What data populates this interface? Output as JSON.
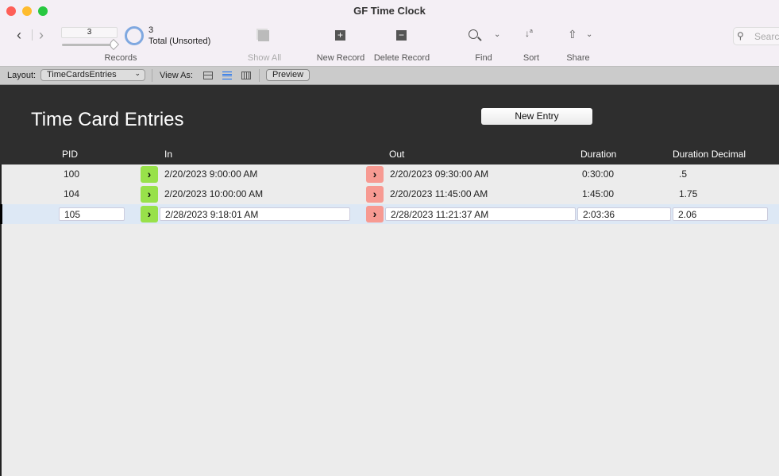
{
  "window": {
    "title": "GF Time Clock"
  },
  "toolbar": {
    "record_number": "3",
    "found_count": "3",
    "total_label": "Total (Unsorted)",
    "records_label": "Records",
    "show_all": "Show All",
    "new_record": "New Record",
    "delete_record": "Delete Record",
    "find": "Find",
    "sort": "Sort",
    "share": "Share",
    "search_placeholder": "Search"
  },
  "layout_bar": {
    "layout_label": "Layout:",
    "layout_value": "TimeCardsEntries",
    "view_as_label": "View As:",
    "preview": "Preview",
    "active_view": "list"
  },
  "header": {
    "title": "Time Card Entries",
    "new_entry": "New Entry",
    "columns": {
      "pid": "PID",
      "in": "In",
      "out": "Out",
      "duration": "Duration",
      "duration_decimal": "Duration Decimal"
    }
  },
  "rows": [
    {
      "pid": "100",
      "in": "2/20/2023 9:00:00 AM",
      "out": "2/20/2023 09:30:00 AM",
      "duration": "0:30:00",
      "duration_decimal": ".5"
    },
    {
      "pid": "104",
      "in": "2/20/2023 10:00:00 AM",
      "out": "2/20/2023 11:45:00 AM",
      "duration": "1:45:00",
      "duration_decimal": "1.75"
    },
    {
      "pid": "105",
      "in": "2/28/2023 9:18:01 AM",
      "out": "2/28/2023 11:21:37 AM",
      "duration": "2:03:36",
      "duration_decimal": "2.06",
      "selected": true
    }
  ],
  "colors": {
    "clock_in": "#98e14a",
    "clock_out": "#f79a92",
    "selected_row": "#dde8f5",
    "header_bg": "#2e2e2e"
  }
}
